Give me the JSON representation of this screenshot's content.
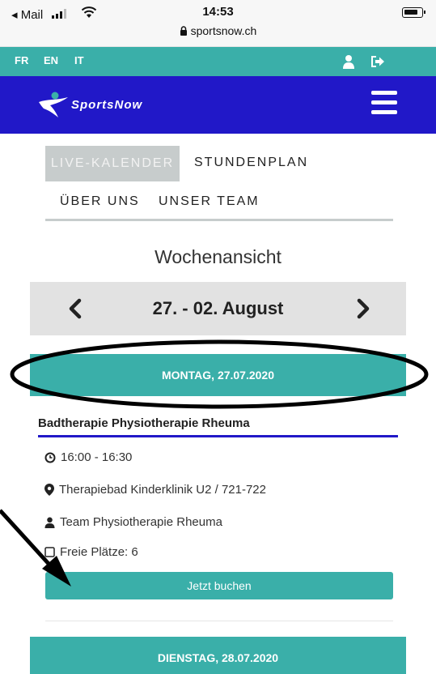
{
  "status_bar": {
    "back_label": "◂ Mail",
    "time": "14:53",
    "url": "sportsnow.ch"
  },
  "languages": [
    "FR",
    "EN",
    "IT"
  ],
  "brand": {
    "name": "SportsNow"
  },
  "nav": {
    "live": "LIVE-KALENDER",
    "stundenplan": "STUNDENPLAN",
    "ueber_uns": "ÜBER UNS",
    "unser_team": "UNSER TEAM"
  },
  "calendar": {
    "view_title": "Wochenansicht",
    "week_range": "27. - 02. August",
    "days": [
      {
        "label": "MONTAG, 27.07.2020",
        "events": [
          {
            "title": "Badtherapie Physiotherapie Rheuma",
            "time": "16:00 - 16:30",
            "location": "Therapiebad Kinderklinik U2 / 721-722",
            "team": "Team Physiotherapie Rheuma",
            "free_spots": "Freie Plätze: 6",
            "book_label": "Jetzt buchen"
          }
        ]
      },
      {
        "label": "DIENSTAG, 28.07.2020"
      }
    ]
  },
  "colors": {
    "teal": "#3aafa9",
    "brand_blue": "#2118c8",
    "nav_active_bg": "#c7cccc"
  }
}
